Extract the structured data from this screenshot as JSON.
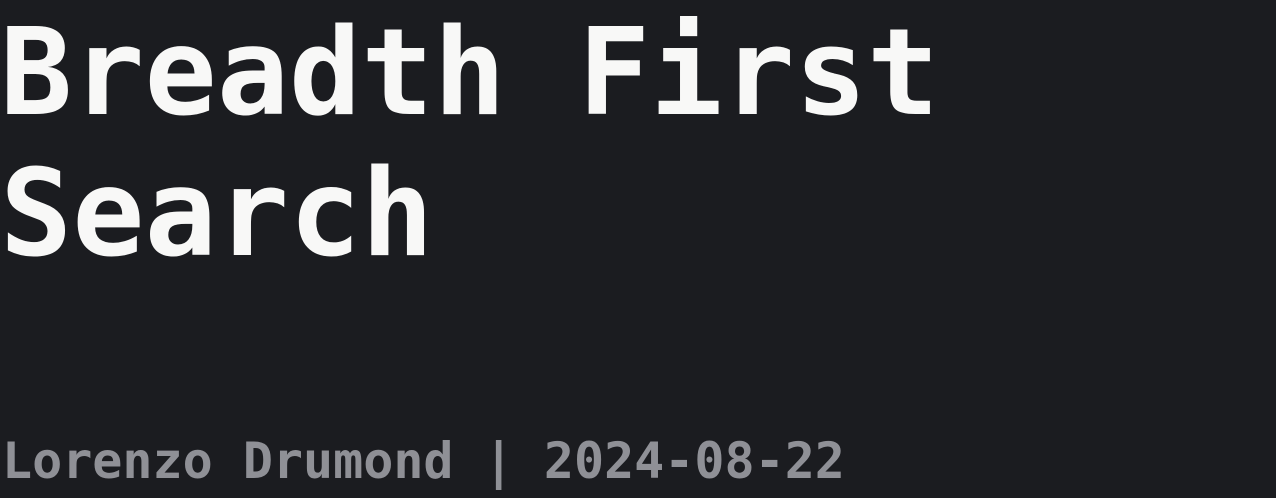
{
  "title": {
    "line1": "Breadth First",
    "line2": "Search"
  },
  "meta": {
    "author": "Lorenzo Drumond",
    "separator": "|",
    "date": "2024-08-22"
  }
}
